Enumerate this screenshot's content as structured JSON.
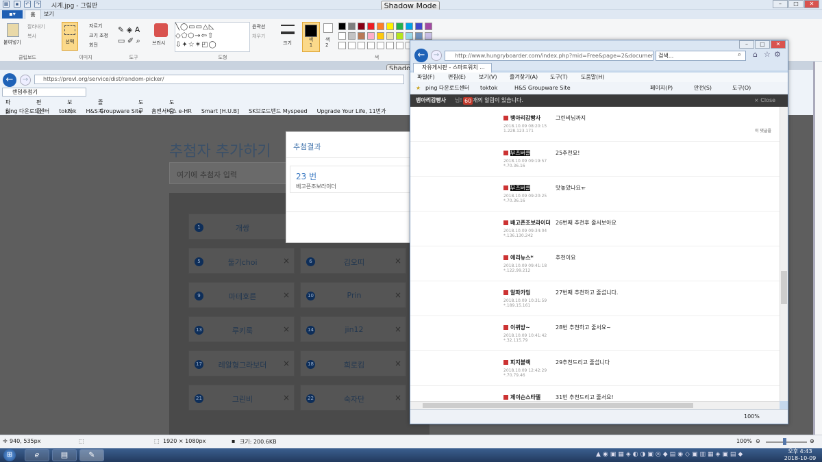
{
  "paint": {
    "title": "시계.jpg - 그림판",
    "shadow_mode": "Shadow Mode",
    "tabs": {
      "file": "▪▾",
      "home": "홈",
      "view": "보기"
    },
    "clipboard": {
      "paste": "붙여넣기",
      "cut": "잘라내기",
      "copy": "복사",
      "label": "클립보드"
    },
    "image": {
      "select": "선택",
      "crop": "자르기",
      "resize": "크기 조정",
      "rotate": "회전",
      "label": "이미지"
    },
    "tools_label": "도구",
    "brush": "브러시",
    "shapes": {
      "outline": "윤곽선",
      "fill": "채우기",
      "label": "도형"
    },
    "size": "크기",
    "color1": "색\n1",
    "color2": "색\n2",
    "colors_label": "색",
    "palette": [
      "#000000",
      "#7f7f7f",
      "#880015",
      "#ed1c24",
      "#ff7f27",
      "#fff200",
      "#22b14c",
      "#00a2e8",
      "#3f48cc",
      "#a349a4",
      "#ffffff",
      "#c3c3c3",
      "#b97a57",
      "#ffaec9",
      "#ffc90e",
      "#efe4b0",
      "#b5e61d",
      "#99d9ea",
      "#7092be",
      "#c8bfe7"
    ],
    "status": {
      "pos": "940, 535px",
      "dims": "1920 × 1080px",
      "size": "크기: 200.6KB",
      "zoom": "100%"
    }
  },
  "inner_browser": {
    "shadow_mode": "Shadow",
    "url": "https://prevl.org/service/dist/random-picker/",
    "tab": "랜덤추첨기",
    "menu": [
      "파일(F)",
      "편집(E)",
      "보기(V)",
      "즐겨찾기(A)",
      "도구(T)",
      "도움말(H)"
    ],
    "favorites": [
      "ping 다운로드센터",
      "toktok",
      "H&S Groupware Site",
      "홈앤서비스 e-HR",
      "Smart [H.U.B]",
      "SK브로드밴드 Myspeed",
      "Upgrade Your Life, 11번가"
    ]
  },
  "picker": {
    "title": "추첨자 추가하기",
    "input_placeholder": "여기에 추첨자 입력",
    "cells": [
      {
        "num": "1",
        "name": "개쌍"
      },
      {
        "num": "5",
        "name": "둘기choi"
      },
      {
        "num": "6",
        "name": "김오띠"
      },
      {
        "num": "9",
        "name": "마테호른"
      },
      {
        "num": "10",
        "name": "Prin"
      },
      {
        "num": "13",
        "name": "루키룩"
      },
      {
        "num": "14",
        "name": "jin12"
      },
      {
        "num": "17",
        "name": "레알형그라보더"
      },
      {
        "num": "18",
        "name": "희로킴"
      },
      {
        "num": "21",
        "name": "그린비"
      },
      {
        "num": "22",
        "name": "숙자단"
      }
    ],
    "remove_glyph": "×",
    "result": {
      "header": "추첨결과",
      "number": "23 번",
      "name": "베고픈조보라이더"
    }
  },
  "ie": {
    "url": "http://www.hungryboarder.com/index.php?mid=Free&page=2&document_srl=",
    "search_placeholder": "검색...",
    "tab": "자유게시판 - 스마트워치 ...",
    "menu": [
      "파일(F)",
      "편집(E)",
      "보기(V)",
      "즐겨찾기(A)",
      "도구(T)",
      "도움말(H)"
    ],
    "favorites": [
      "ping 다운로드센터",
      "toktok",
      "H&S Groupware Site"
    ],
    "cmd": [
      "페이지(P)",
      "안전(S)",
      "도구(O)"
    ],
    "notice_user": "뱅아리감빵사",
    "notice_mid": "님!",
    "notice_count": "60",
    "notice_text": "개의 알림이 있습니다.",
    "close": "× Close",
    "reply_label": "이 댓글을",
    "zoom": "100%",
    "comments": [
      {
        "nick": "뱅아리감빵사",
        "meta": "2018.10.09 08:20:15\n1.228.123.171",
        "text": "그린비님까지"
      },
      {
        "nick": "부츠버클",
        "meta": "2018.10.09 09:19:57\n*.70.36.16",
        "text": "25추천요!"
      },
      {
        "nick": "부츠버클",
        "meta": "2018.10.09 09:20:25\n*.70.36.16",
        "text": "맛놓았나요ㅠ"
      },
      {
        "nick": "배고픈조보라이더",
        "meta": "2018.10.09 09:34:04\n*.136.130.242",
        "text": "26번째 추천후 줄서보아요"
      },
      {
        "nick": "에리뉴스*",
        "meta": "2018.10.09 09:41:18\n*.122.99.212",
        "text": "추천이요"
      },
      {
        "nick": "알파카밍",
        "meta": "2018.10.09 10:31:59\n*.189.15.161",
        "text": "27번째 추천하고 줄섭니다."
      },
      {
        "nick": "이퀴방~",
        "meta": "2018.10.09 10:41:42\n*.32.115.79",
        "text": "28번 추천하고 줄서요~"
      },
      {
        "nick": "피지블랙",
        "meta": "2018.10.09 12:42:29\n*.70.79.46",
        "text": "29추천드리고 줄섭니다"
      },
      {
        "nick": "제이슨스타델",
        "meta": "2018.10.09 13:00:12",
        "text": "31번 추천드리고 줄서요!"
      }
    ]
  },
  "taskbar": {
    "time": "오후 4:43",
    "date": "2018-10-09"
  }
}
